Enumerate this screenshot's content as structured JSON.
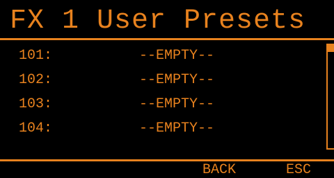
{
  "screen": {
    "title": "FX 1 User Presets"
  },
  "presets": [
    {
      "number": "101:",
      "name": "--EMPTY--"
    },
    {
      "number": "102:",
      "name": "--EMPTY--"
    },
    {
      "number": "103:",
      "name": "--EMPTY--"
    },
    {
      "number": "104:",
      "name": "--EMPTY--"
    }
  ],
  "softkeys": {
    "back": "BACK",
    "esc": "ESC"
  },
  "colors": {
    "accent": "#e8821e",
    "background": "#000000"
  }
}
